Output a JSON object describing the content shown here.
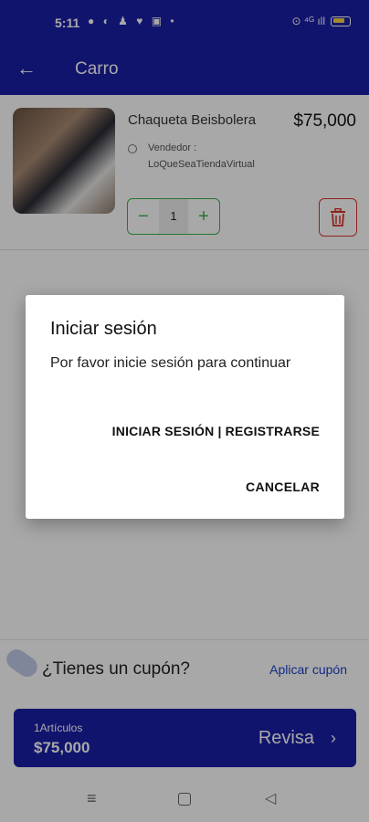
{
  "status_bar": {
    "time": "5:11",
    "icons_left": "● ◐ ♟ ♥ ▣  •",
    "icons_right": "⊙ ⁴ᴳ ıll"
  },
  "app_bar": {
    "title": "Carro",
    "back_icon": "←"
  },
  "cart_item": {
    "name": "Chaqueta Beisbolera",
    "price": "$75,000",
    "seller_label": "Vendedor :",
    "seller_name": "LoQueSeaTiendaVirtual",
    "quantity": "1",
    "minus": "−",
    "plus": "+",
    "delete_icon": "trash-icon"
  },
  "coupon": {
    "text": "¿Tienes un cupón?",
    "link": "Aplicar cupón"
  },
  "checkout": {
    "count": "1Artículos",
    "total": "$75,000",
    "label": "Revisa",
    "chevron": "›"
  },
  "nav": {
    "recents": "≡",
    "back": "◁"
  },
  "dialog": {
    "title": "Iniciar sesión",
    "message": "Por favor inicie sesión para continuar",
    "login_register": "INICIAR SESIÓN | REGISTRARSE",
    "cancel": "CANCELAR"
  },
  "colors": {
    "primary": "#1a1fa6",
    "accent_green": "#3bb24a",
    "danger_red": "#d9352b",
    "link_blue": "#1d40c8"
  }
}
